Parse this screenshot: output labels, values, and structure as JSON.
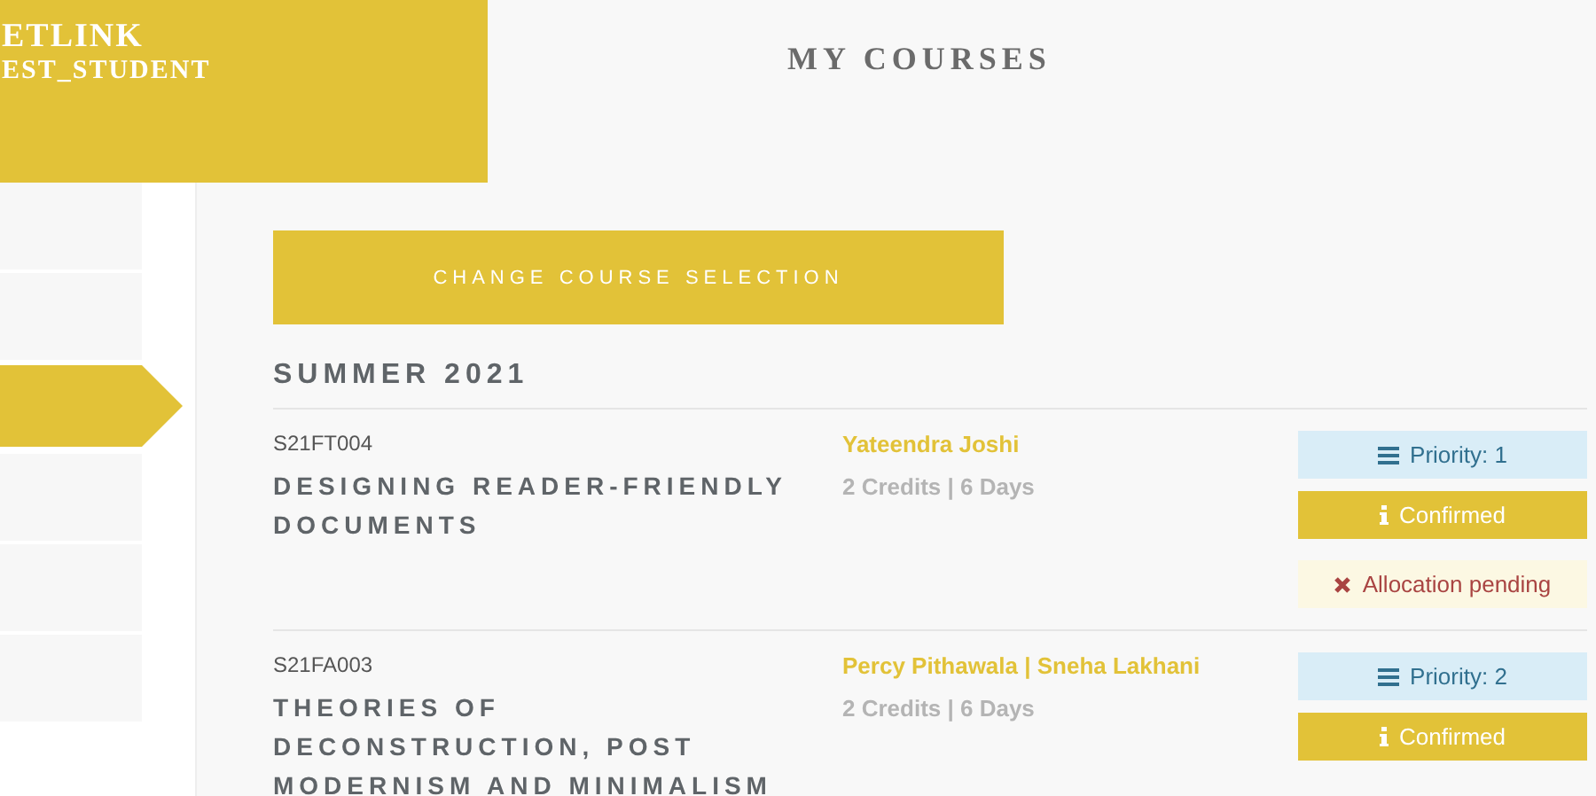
{
  "brand": {
    "name": "ETLINK",
    "user": "EST_STUDENT"
  },
  "sidebar": {
    "items": [
      {
        "selected": false
      },
      {
        "selected": false
      },
      {
        "selected": true
      },
      {
        "selected": false
      },
      {
        "selected": false
      },
      {
        "selected": false
      }
    ]
  },
  "page_title": "MY COURSES",
  "change_button": "CHANGE COURSE SELECTION",
  "term": "SUMMER 2021",
  "courses": [
    {
      "code": "S21FT004",
      "title": "DESIGNING READER-FRIENDLY DOCUMENTS",
      "instructor": "Yateendra Joshi",
      "meta": "2 Credits | 6 Days",
      "statuses": [
        {
          "kind": "priority",
          "text": "Priority: 1"
        },
        {
          "kind": "confirmed",
          "text": "Confirmed"
        },
        {
          "kind": "pending",
          "text": "Allocation pending"
        }
      ]
    },
    {
      "code": "S21FA003",
      "title": "THEORIES OF DECONSTRUCTION, POST MODERNISM AND MINIMALISM",
      "instructor": "Percy Pithawala | Sneha Lakhani",
      "meta": "2 Credits | 6 Days",
      "statuses": [
        {
          "kind": "priority",
          "text": "Priority: 2"
        },
        {
          "kind": "confirmed",
          "text": "Confirmed"
        }
      ]
    }
  ]
}
